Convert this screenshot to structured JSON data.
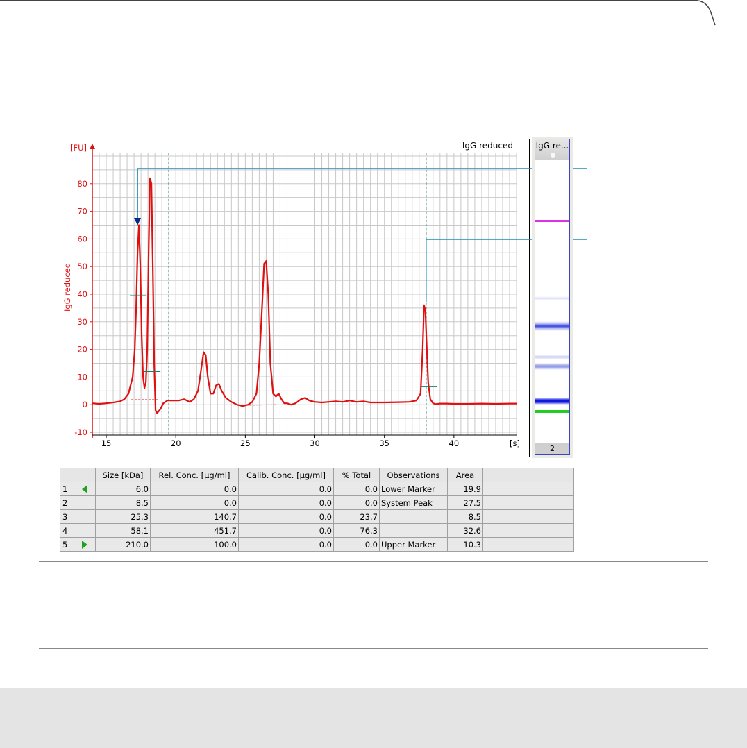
{
  "chart_data": {
    "type": "line",
    "title": "IgG reduced",
    "ylabel": "IgG reduced",
    "yunit": "[FU]",
    "xunit": "[s]",
    "xlim": [
      14,
      44.5
    ],
    "ylim": [
      -11,
      91
    ],
    "xticks": [
      15,
      20,
      25,
      30,
      35,
      40
    ],
    "yticks": [
      -10,
      0,
      10,
      20,
      30,
      40,
      50,
      60,
      70,
      80
    ],
    "grid": true,
    "line_color": "#e01010",
    "series": [
      {
        "x": [
          14.0,
          14.5,
          15.0,
          15.5,
          16.0,
          16.3,
          16.6,
          16.9,
          17.05,
          17.15,
          17.25,
          17.35,
          17.45,
          17.55,
          17.65,
          17.75,
          17.85,
          17.95,
          18.05,
          18.15,
          18.25,
          18.35,
          18.45,
          18.55,
          18.65,
          18.75,
          18.9,
          19.1,
          19.4,
          19.8,
          20.2,
          20.6,
          21.0,
          21.3,
          21.6,
          21.8,
          22.0,
          22.15,
          22.3,
          22.5,
          22.7,
          22.9,
          23.1,
          23.3,
          23.6,
          24.0,
          24.4,
          24.8,
          25.2,
          25.5,
          25.8,
          26.0,
          26.2,
          26.35,
          26.5,
          26.65,
          26.8,
          27.0,
          27.2,
          27.4,
          27.6,
          27.8,
          28.0,
          28.3,
          28.6,
          29.0,
          29.3,
          29.6,
          30.0,
          30.5,
          31.0,
          31.5,
          32.0,
          32.5,
          33.0,
          33.5,
          34.0,
          35.0,
          36.0,
          36.8,
          37.3,
          37.6,
          37.75,
          37.85,
          37.95,
          38.05,
          38.15,
          38.3,
          38.5,
          38.7,
          39.0,
          39.5,
          40.0,
          41.0,
          42.0,
          43.0,
          44.0,
          44.5
        ],
        "y": [
          0.5,
          0.3,
          0.5,
          0.8,
          1.2,
          2.0,
          4.0,
          10.0,
          20.0,
          35.0,
          55.0,
          65.0,
          50.0,
          25.0,
          10.0,
          6.0,
          8.0,
          20.0,
          55.0,
          82.0,
          80.0,
          50.0,
          15.0,
          -2.0,
          -3.0,
          -2.5,
          -1.5,
          0.5,
          1.5,
          1.5,
          1.5,
          2.0,
          1.0,
          2.0,
          5.0,
          12.0,
          19.0,
          18.0,
          10.0,
          4.0,
          4.0,
          7.0,
          7.5,
          5.0,
          2.5,
          1.0,
          0.0,
          -0.5,
          0.0,
          1.0,
          4.0,
          15.0,
          35.0,
          51.0,
          52.0,
          40.0,
          15.0,
          4.0,
          3.0,
          4.0,
          2.0,
          0.5,
          0.5,
          0.0,
          0.5,
          2.0,
          2.5,
          1.5,
          1.0,
          0.8,
          1.0,
          1.2,
          1.0,
          1.5,
          1.0,
          1.2,
          0.8,
          0.8,
          0.9,
          1.0,
          1.5,
          4.0,
          20.0,
          36.0,
          34.0,
          20.0,
          8.0,
          2.0,
          0.5,
          0.2,
          0.4,
          0.4,
          0.3,
          0.3,
          0.4,
          0.3,
          0.4,
          0.4
        ]
      }
    ],
    "vertical_markers": [
      19.5,
      38.0
    ],
    "baselines": [
      {
        "x": [
          16.8,
          18.7
        ],
        "y": [
          1.8,
          1.8
        ]
      },
      {
        "x": [
          24.8,
          27.3
        ],
        "y": [
          -0.2,
          0.0
        ]
      }
    ],
    "peak_ticks": [
      {
        "x": 17.3,
        "y": 39.5
      },
      {
        "x": 18.3,
        "y": 12.0
      },
      {
        "x": 22.1,
        "y": 10.0
      },
      {
        "x": 26.5,
        "y": 10.0
      },
      {
        "x": 38.2,
        "y": 6.5
      }
    ]
  },
  "gel": {
    "title": "IgG re...",
    "lane_number": "2"
  },
  "results_table": {
    "headers": [
      "",
      "",
      "Size [kDa]",
      "Rel. Conc. [µg/ml]",
      "Calib. Conc. [µg/ml]",
      "% Total",
      "Observations",
      "Area",
      ""
    ],
    "rows": [
      {
        "index": "1",
        "marker": "left",
        "size": "6.0",
        "rel_conc": "0.0",
        "calib_conc": "0.0",
        "pct_total": "0.0",
        "observation": "Lower Marker",
        "area": "19.9"
      },
      {
        "index": "2",
        "marker": "",
        "size": "8.5",
        "rel_conc": "0.0",
        "calib_conc": "0.0",
        "pct_total": "0.0",
        "observation": "System Peak",
        "area": "27.5"
      },
      {
        "index": "3",
        "marker": "",
        "size": "25.3",
        "rel_conc": "140.7",
        "calib_conc": "0.0",
        "pct_total": "23.7",
        "observation": "",
        "area": "8.5"
      },
      {
        "index": "4",
        "marker": "",
        "size": "58.1",
        "rel_conc": "451.7",
        "calib_conc": "0.0",
        "pct_total": "76.3",
        "observation": "",
        "area": "32.6"
      },
      {
        "index": "5",
        "marker": "right",
        "size": "210.0",
        "rel_conc": "100.0",
        "calib_conc": "0.0",
        "pct_total": "0.0",
        "observation": "Upper Marker",
        "area": "10.3"
      }
    ]
  },
  "colors": {
    "axis": "#e01010",
    "marker_line": "#1f8fb0",
    "grid": "#c8c8c8",
    "marker_dash": "#1a7a6a"
  }
}
